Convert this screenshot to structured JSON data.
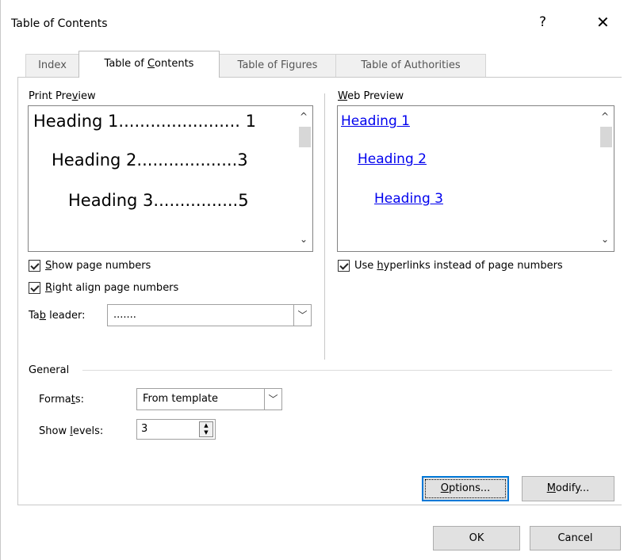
{
  "dialog": {
    "title": "Table of Contents",
    "help_label": "?",
    "close_label": "✕"
  },
  "tabs": [
    {
      "label": "Index",
      "active": false
    },
    {
      "label": "Table of Contents",
      "active": true
    },
    {
      "label": "Table of Figures",
      "active": false
    },
    {
      "label": "Table of Authorities",
      "active": false
    }
  ],
  "print_preview": {
    "label": "Print Preview",
    "lines": [
      {
        "text": "Heading 1",
        "leader": ".......................",
        "page": "1"
      },
      {
        "text": "Heading 2",
        "leader": "...................",
        "page": "3"
      },
      {
        "text": "Heading 3",
        "leader": "................",
        "page": "5"
      }
    ]
  },
  "web_preview": {
    "label": "Web Preview",
    "links": [
      "Heading 1",
      "Heading 2",
      "Heading 3"
    ]
  },
  "options": {
    "show_page_numbers": {
      "label": "Show page numbers",
      "checked": true
    },
    "right_align": {
      "label": "Right align page numbers",
      "checked": true
    },
    "hyperlinks": {
      "label": "Use hyperlinks instead of page numbers",
      "checked": true
    },
    "tab_leader": {
      "label": "Tab leader:",
      "value": "......."
    }
  },
  "general": {
    "label": "General",
    "formats": {
      "label": "Formats:",
      "value": "From template"
    },
    "show_levels": {
      "label": "Show levels:",
      "value": "3"
    }
  },
  "buttons": {
    "options": "Options...",
    "modify": "Modify...",
    "ok": "OK",
    "cancel": "Cancel"
  },
  "icons": {
    "chevron_up": "^",
    "chevron_down": "⌄",
    "combo_arrow": "﹀",
    "spin_up": "▲",
    "spin_down": "▼"
  }
}
